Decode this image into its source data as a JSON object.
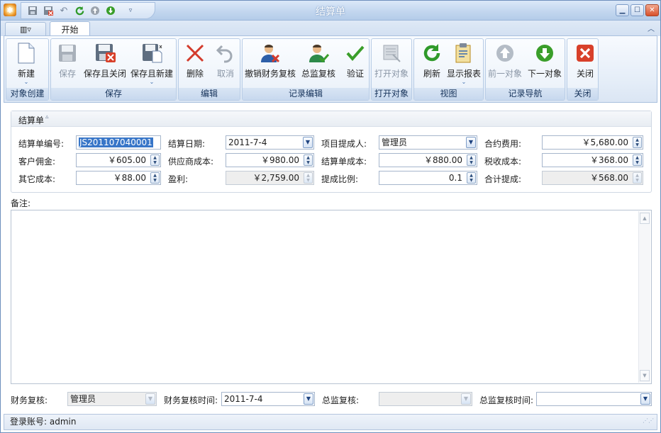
{
  "window": {
    "title": "结算单"
  },
  "tabs": {
    "app_menu": "▥▿",
    "start": "开始"
  },
  "ribbon": {
    "groups": [
      "对象创建",
      "保存",
      "编辑",
      "记录编辑",
      "打开对象",
      "视图",
      "记录导航",
      "关闭"
    ],
    "buttons": {
      "new": "新建",
      "save": "保存",
      "save_close": "保存且关闭",
      "save_new": "保存且新建",
      "delete": "删除",
      "cancel": "取消",
      "revoke_finance_review": "撤销财务复核",
      "director_review": "总监复核",
      "validate": "验证",
      "open_object": "打开对象",
      "refresh": "刷新",
      "show_report": "显示报表",
      "prev_object": "前一对象",
      "next_object": "下一对象",
      "close": "关闭"
    }
  },
  "form": {
    "panel_title": "结算单",
    "fields": {
      "settlement_no": {
        "label": "结算单编号:",
        "value": "JS201107040001"
      },
      "settlement_date": {
        "label": "结算日期:",
        "value": "2011-7-4"
      },
      "project_proposer": {
        "label": "项目提成人:",
        "value": "管理员"
      },
      "contract_fee": {
        "label": "合约费用:",
        "value": "￥5,680.00"
      },
      "customer_commission": {
        "label": "客户佣金:",
        "value": "￥605.00"
      },
      "supplier_cost": {
        "label": "供应商成本:",
        "value": "￥980.00"
      },
      "settlement_cost": {
        "label": "结算单成本:",
        "value": "￥880.00"
      },
      "tax_cost": {
        "label": "税收成本:",
        "value": "￥368.00"
      },
      "other_cost": {
        "label": "其它成本:",
        "value": "￥88.00"
      },
      "profit": {
        "label": "盈利:",
        "value": "￥2,759.00"
      },
      "commission_ratio": {
        "label": "提成比例:",
        "value": "0.1"
      },
      "total_commission": {
        "label": "合计提成:",
        "value": "￥568.00"
      }
    },
    "remarks_label": "备注:",
    "remarks_value": "",
    "bottom": {
      "finance_review": {
        "label": "财务复核:",
        "value": "管理员"
      },
      "finance_review_time": {
        "label": "财务复核时间:",
        "value": "2011-7-4"
      },
      "director_review": {
        "label": "总监复核:",
        "value": ""
      },
      "director_review_time": {
        "label": "总监复核时间:",
        "value": ""
      }
    }
  },
  "status": {
    "text": "登录账号: admin"
  },
  "colors": {
    "accent": "#3876c8",
    "title_bar": "#c3d7ef",
    "delete_red": "#d33b2c",
    "green": "#3a9e2a"
  }
}
